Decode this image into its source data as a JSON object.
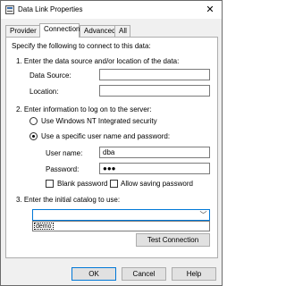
{
  "window": {
    "title": "Data Link Properties",
    "close_glyph": "✕"
  },
  "tabs": [
    {
      "label": "Provider"
    },
    {
      "label": "Connection"
    },
    {
      "label": "Advanced"
    },
    {
      "label": "All"
    }
  ],
  "connection": {
    "intro": "Specify the following to connect to this data:",
    "step1": {
      "heading": "1. Enter the data source and/or location of the data:",
      "data_source_label": "Data Source:",
      "data_source_value": "",
      "location_label": "Location:",
      "location_value": ""
    },
    "step2": {
      "heading": "2. Enter information to log on to the server:",
      "radio_nt": "Use Windows NT Integrated security",
      "radio_specific": "Use a specific user name and password:",
      "username_label": "User name:",
      "username_value": "dba",
      "password_label": "Password:",
      "password_value": "●●●",
      "blank_password_label": "Blank password",
      "allow_saving_label": "Allow saving password"
    },
    "step3": {
      "heading": "3. Enter the initial catalog to use:",
      "catalog_value": "",
      "catalog_options": [
        "demo"
      ]
    },
    "test_button": "Test Connection"
  },
  "buttons": {
    "ok": "OK",
    "cancel": "Cancel",
    "help": "Help"
  }
}
